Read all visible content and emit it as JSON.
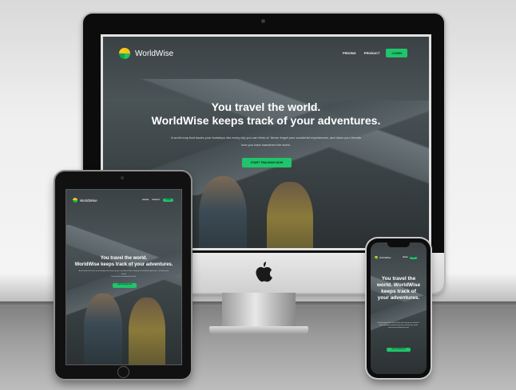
{
  "brand": {
    "name": "WorldWise"
  },
  "nav": {
    "pricing": "PRICING",
    "product": "PRODUCT",
    "login": "LOGIN"
  },
  "hero": {
    "title_line1": "You travel the world.",
    "title_line2": "WorldWise keeps track of your adventures.",
    "subtitle_line1": "A world map that tracks your footsteps into every city you can think of. Never forget your wonderful experiences, and show your friends",
    "subtitle_line2": "how you have wandered the world.",
    "cta": "START TRACKING NOW"
  },
  "phone": {
    "time": "9:41",
    "title": "You travel the world. WorldWise keeps track of your adventures."
  },
  "colors": {
    "accent": "#1fc56a",
    "device_frame": "#111111"
  }
}
